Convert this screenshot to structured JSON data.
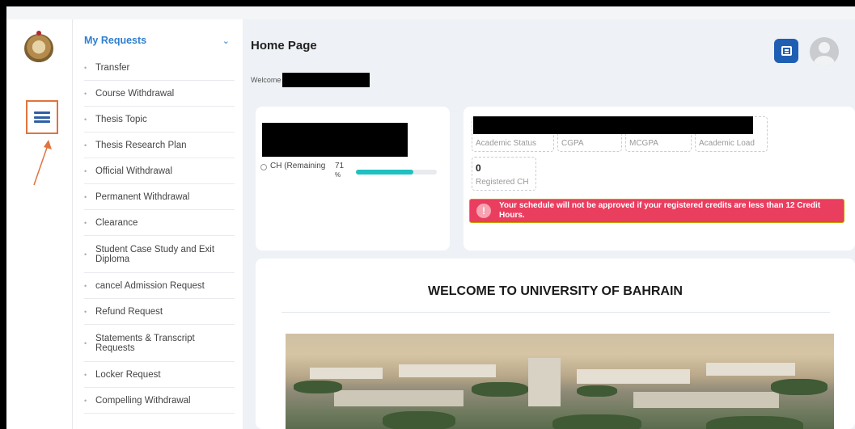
{
  "sidebar": {
    "section_title": "My Requests",
    "items": [
      {
        "label": "Transfer"
      },
      {
        "label": "Course Withdrawal"
      },
      {
        "label": "Thesis Topic"
      },
      {
        "label": "Thesis Research Plan"
      },
      {
        "label": "Official Withdrawal"
      },
      {
        "label": "Permanent Withdrawal"
      },
      {
        "label": "Clearance"
      },
      {
        "label": "Student Case Study and Exit Diploma"
      },
      {
        "label": "cancel Admission Request"
      },
      {
        "label": "Refund Request"
      },
      {
        "label": "Statements & Transcript Requests"
      },
      {
        "label": "Locker Request"
      },
      {
        "label": "Compelling Withdrawal"
      }
    ]
  },
  "header": {
    "title": "Home Page",
    "welcome": "Welcome"
  },
  "progress_card": {
    "label": "CH (Remaining",
    "percent_value": "71",
    "percent_unit": "%",
    "progress_fraction": 0.71
  },
  "stats": {
    "academic_status": "Academic Status",
    "cgpa": "CGPA",
    "mcgpa": "MCGPA",
    "academic_load": "Academic Load",
    "registered_ch_value": "0",
    "registered_ch_label": "Registered CH"
  },
  "alert": {
    "icon": "!",
    "message": "Your schedule will not be approved if your registered credits are less than 12 Credit Hours."
  },
  "welcome_section": {
    "heading": "WELCOME TO UNIVERSITY OF BAHRAIN"
  },
  "colors": {
    "accent": "#2f7fd1",
    "chat_button": "#1f5fb3",
    "progress": "#20c0c0",
    "alert": "#ea3e5f",
    "highlight": "#e0743d"
  }
}
